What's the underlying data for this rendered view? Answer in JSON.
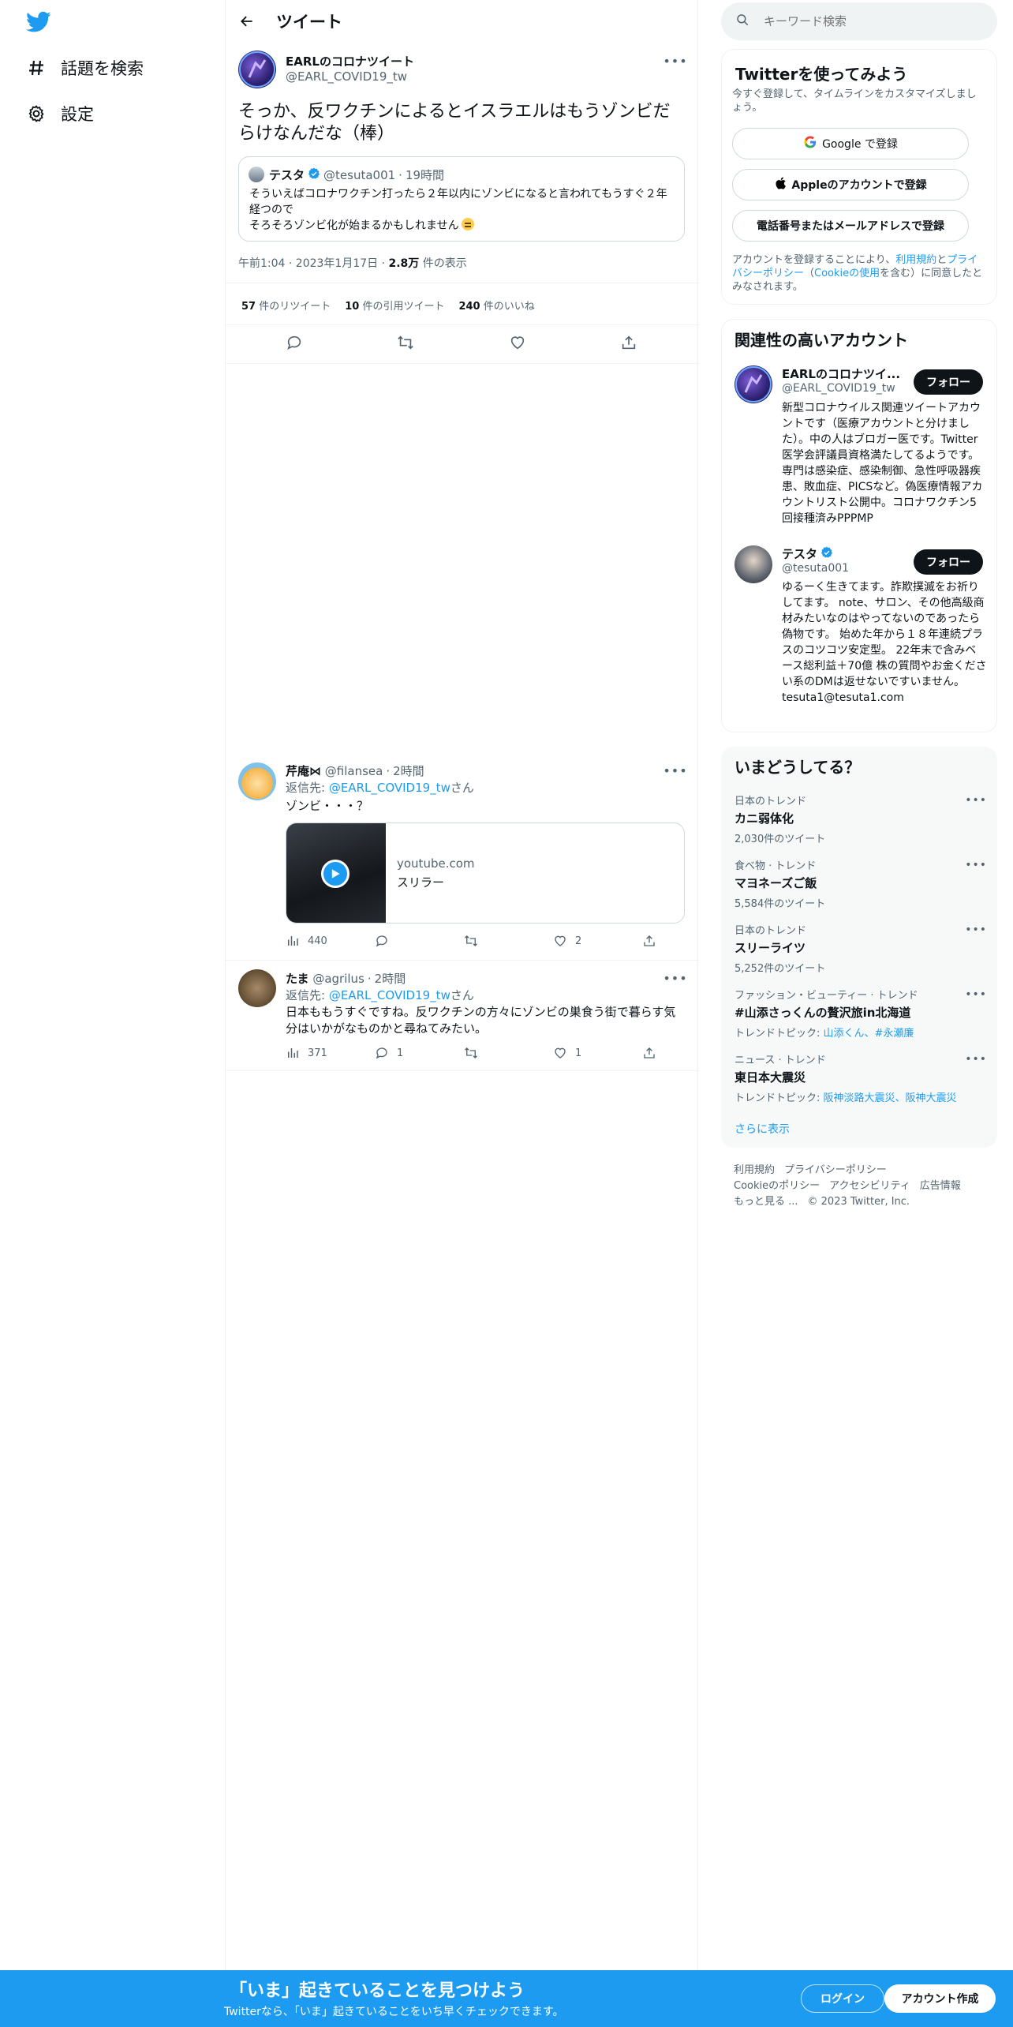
{
  "left_nav": {
    "explore_label": "話題を検索",
    "settings_label": "設定"
  },
  "header": {
    "title": "ツイート"
  },
  "tweet": {
    "author_name": "EARLのコロナツイート",
    "author_handle": "@EARL_COVID19_tw",
    "text": "そっか、反ワクチンによるとイスラエルはもうゾンビだらけなんだな（棒）",
    "quote": {
      "name": "テスタ",
      "handle": "@tesuta001",
      "sep": "·",
      "time": "19時間",
      "text_line1": "そういえばコロナワクチン打ったら２年以内にゾンビになると言われてもうすぐ２年経つので",
      "text_line2": "そろそろゾンビ化が始まるかもしれません"
    },
    "time": "午前1:04 · 2023年1月17日 · ",
    "views_count": "2.8万",
    "views_label": " 件の表示",
    "retweets_count": "57",
    "retweets_label": " 件のリツイート",
    "quotes_count": "10",
    "quotes_label": " 件の引用ツイート",
    "likes_count": "240",
    "likes_label": " 件のいいね"
  },
  "replies": [
    {
      "name": "芹庵⋈",
      "handle": "@filansea",
      "sep": "·",
      "time": "2時間",
      "reply_to_prefix": "返信先: ",
      "reply_to": "@EARL_COVID19_tw",
      "reply_to_suffix": "さん",
      "text": "ゾンビ・・・？",
      "link_domain": "youtube.com",
      "link_title": "スリラー",
      "views": "440",
      "replies": "",
      "retweets": "",
      "likes": "2"
    },
    {
      "name": "たま",
      "handle": "@agrilus",
      "sep": "·",
      "time": "2時間",
      "reply_to_prefix": "返信先: ",
      "reply_to": "@EARL_COVID19_tw",
      "reply_to_suffix": "さん",
      "text": "日本ももうすぐですね。反ワクチンの方々にゾンビの巣食う街で暮らす気分はいかがなものかと尋ねてみたい。",
      "views": "371",
      "replies": "1",
      "retweets": "",
      "likes": "1"
    }
  ],
  "search": {
    "placeholder": "キーワード検索"
  },
  "signup": {
    "title": "Twitterを使ってみよう",
    "subtitle": "今すぐ登録して、タイムラインをカスタマイズしましょう。",
    "google": "Google で登録",
    "apple": "Appleのアカウントで登録",
    "phone": "電話番号またはメールアドレスで登録",
    "legal_1": "アカウントを登録することにより、",
    "legal_terms": "利用規約",
    "legal_2": "と",
    "legal_privacy": "プライバシーポリシー",
    "legal_3": "（",
    "legal_cookie": "Cookieの使用",
    "legal_4": "を含む）に同意したとみなされます。"
  },
  "related": {
    "title": "関連性の高いアカウント",
    "follow": "フォロー",
    "accounts": [
      {
        "name": "EARLのコロナツイ...",
        "handle": "@EARL_COVID19_tw",
        "bio": "新型コロナウイルス関連ツイートアカウントです（医療アカウントと分けました）。中の人はブロガー医です。Twitter医学会評議員資格満たしてるようです。専門は感染症、感染制御、急性呼吸器疾患、敗血症、PICSなど。偽医療情報アカウントリスト公開中。コロナワクチン5回接種済みPPPMP"
      },
      {
        "name": "テスタ",
        "handle": "@tesuta001",
        "bio": "ゆるーく生きてます。詐欺撲滅をお祈りしてます。 note、サロン、その他高級商材みたいなのはやってないのであったら偽物です。 始めた年から１８年連続プラスのコツコツ安定型。 22年末で含みベース総利益＋70億 株の質問やお金ください系のDMは返せないですいません。",
        "bio2": "tesuta1@tesuta1.com"
      }
    ]
  },
  "trends": {
    "title": "いまどうしてる？",
    "items": [
      {
        "category": "日本のトレンド",
        "name": "カニ弱体化",
        "count": "2,030件のツイート"
      },
      {
        "category": "食べ物 · トレンド",
        "name": "マヨネーズご飯",
        "count": "5,584件のツイート"
      },
      {
        "category": "日本のトレンド",
        "name": "スリーライツ",
        "count": "5,252件のツイート"
      },
      {
        "category": "ファッション・ビューティー · トレンド",
        "name": "#山添さっくんの贅沢旅in北海道",
        "topic_label": "トレンドトピック: ",
        "topic_links": "山添くん、#永瀬廉"
      },
      {
        "category": "ニュース · トレンド",
        "name": "東日本大震災",
        "topic_label": "トレンドトピック: ",
        "topic_links": "阪神淡路大震災、阪神大震災"
      }
    ],
    "show_more": "さらに表示"
  },
  "footer": {
    "terms": "利用規約",
    "privacy": "プライバシーポリシー",
    "cookie": "Cookieのポリシー",
    "accessibility": "アクセシビリティ",
    "ads": "広告情報",
    "more": "もっと見る ...",
    "copyright": "© 2023 Twitter, Inc."
  },
  "bottom_bar": {
    "title": "「いま」起きていることを見つけよう",
    "subtitle": "Twitterなら、「いま」起きていることをいち早くチェックできます。",
    "login": "ログイン",
    "signup": "アカウント作成"
  },
  "colors": {
    "accent": "#1d9bf0",
    "text": "#0f1419",
    "muted": "#536471"
  }
}
